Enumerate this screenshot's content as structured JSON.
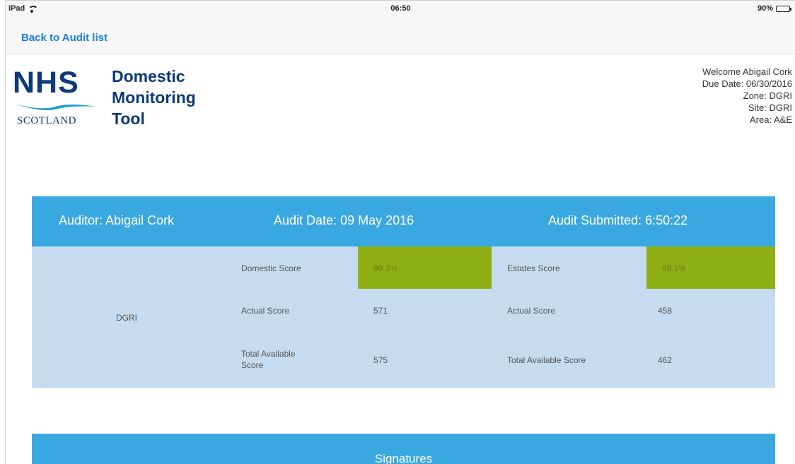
{
  "status_bar": {
    "device": "iPad",
    "time": "06:50",
    "battery": "90%"
  },
  "nav": {
    "back_label": "Back to Audit list"
  },
  "logo": {
    "nhs": "NHS",
    "scotland": "SCOTLAND",
    "title_line1": "Domestic",
    "title_line2": "Monitoring",
    "title_line3": "Tool"
  },
  "user_info": {
    "welcome": "Welcome Abigail Cork",
    "due_date": "Due Date: 06/30/2016",
    "zone": "Zone: DGRI",
    "site": "Site: DGRI",
    "area": "Area: A&E"
  },
  "summary": {
    "auditor": "Auditor: Abigail Cork",
    "audit_date": "Audit Date: 09 May 2016",
    "submitted": "Audit Submitted: 6:50:22",
    "site": "DGRI",
    "domestic": {
      "score_label": "Domestic Score",
      "score_value": "99.3%",
      "actual_label": "Actual Score",
      "actual_value": "571",
      "total_label": "Total Available Score",
      "total_value": "575"
    },
    "estates": {
      "score_label": "Estates Score",
      "score_value": "99.1%",
      "actual_label": "Actual Score",
      "actual_value": "458",
      "total_label": "Total Available Score",
      "total_value": "462"
    },
    "highlight_color": "#8fb014",
    "header_color": "#3aa8e0"
  },
  "signatures": {
    "title": "Signatures"
  }
}
